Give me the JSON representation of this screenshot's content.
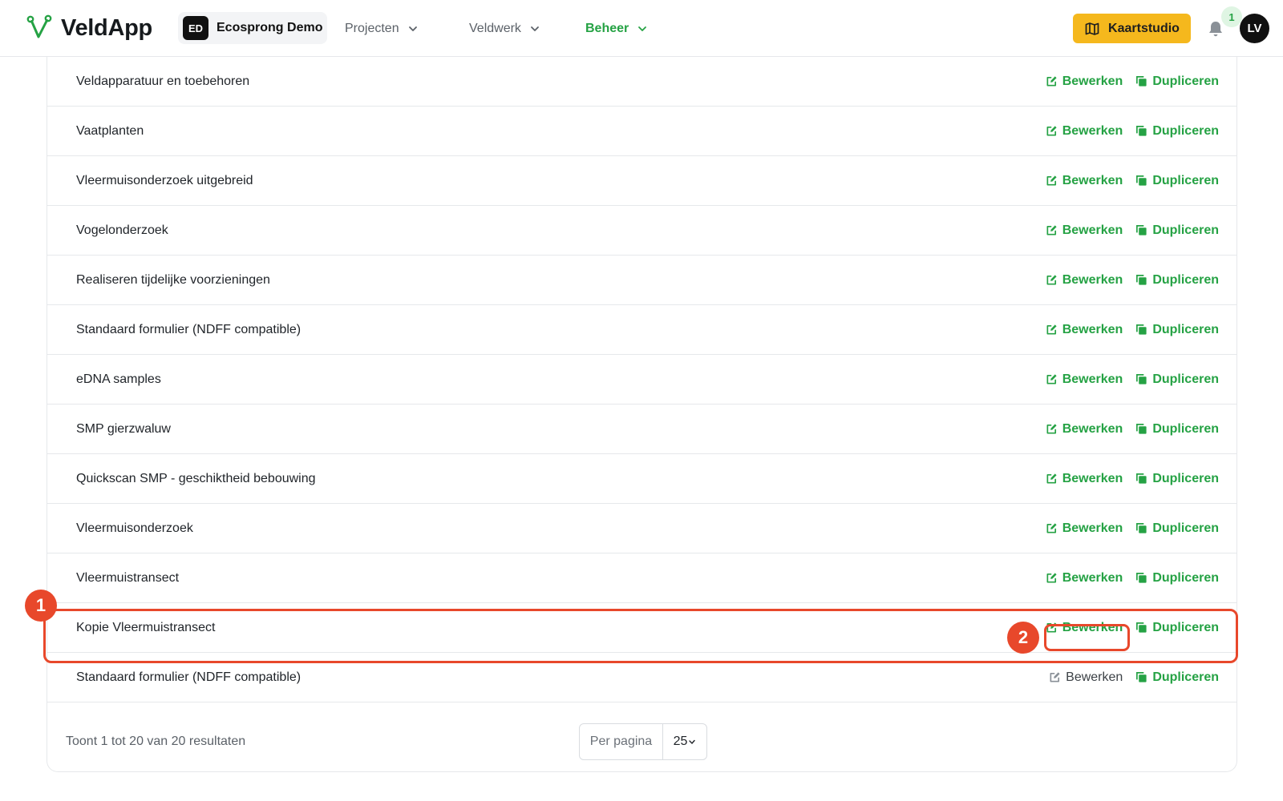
{
  "header": {
    "app_name": "VeldApp",
    "org_initials": "ED",
    "org_name": "Ecosprong Demo",
    "nav": [
      {
        "label": "Projecten",
        "active": false
      },
      {
        "label": "Veldwerk",
        "active": false
      },
      {
        "label": "Beheer",
        "active": true
      }
    ],
    "kaartstudio_label": "Kaartstudio",
    "notification_count": "1",
    "avatar_initials": "LV"
  },
  "rows": [
    {
      "name": "Veldapparatuur en toebehoren"
    },
    {
      "name": "Vaatplanten"
    },
    {
      "name": "Vleermuisonderzoek uitgebreid"
    },
    {
      "name": "Vogelonderzoek"
    },
    {
      "name": "Realiseren tijdelijke voorzieningen"
    },
    {
      "name": "Standaard formulier (NDFF compatible)"
    },
    {
      "name": "eDNA samples"
    },
    {
      "name": "SMP gierzwaluw"
    },
    {
      "name": "Quickscan SMP - geschiktheid bebouwing"
    },
    {
      "name": "Vleermuisonderzoek"
    },
    {
      "name": "Vleermuistransect"
    },
    {
      "name": "Kopie Vleermuistransect"
    },
    {
      "name": "Standaard formulier (NDFF compatible)"
    }
  ],
  "actions": {
    "edit_label": "Bewerken",
    "duplicate_label": "Dupliceren"
  },
  "footer": {
    "results_text": "Toont 1 tot 20 van 20 resultaten",
    "per_page_label": "Per pagina",
    "per_page_value": "25"
  },
  "annotations": {
    "step1": "1",
    "step2": "2"
  },
  "colors": {
    "accent_green": "#25a244",
    "kaartstudio_yellow": "#f5b81d",
    "annotation_red": "#e8482b"
  }
}
